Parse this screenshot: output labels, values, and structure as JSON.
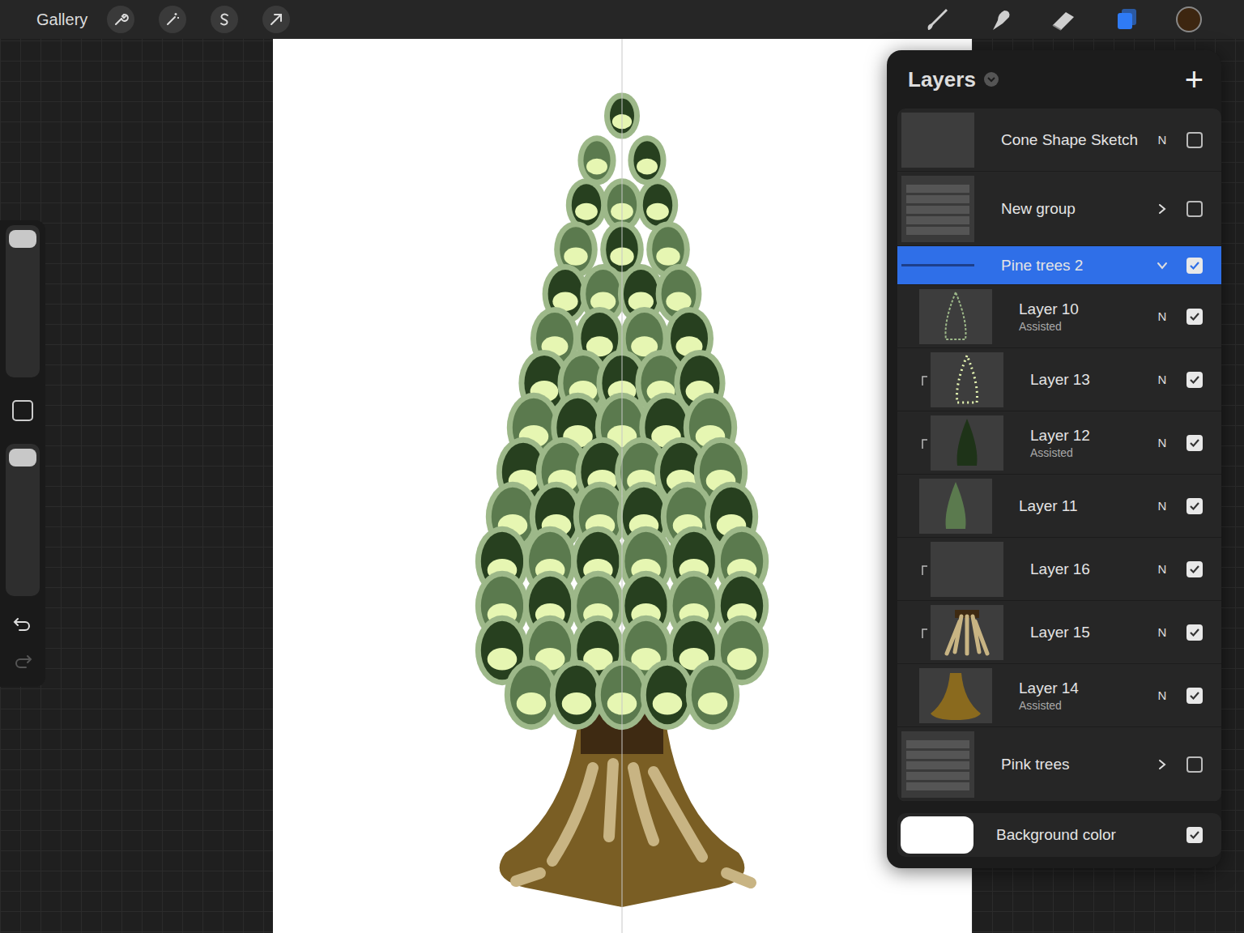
{
  "toolbar": {
    "gallery": "Gallery",
    "current_color": "#3d2610",
    "layers_open": true
  },
  "sidebar": {
    "size_slider": {
      "level": 1
    },
    "opacity_slider": {
      "level": 1
    },
    "redo_disabled": true
  },
  "layers_panel": {
    "title": "Layers",
    "add": "+",
    "rows": [
      {
        "name": "Cone Shape Sketch",
        "kind": "layer",
        "subtitle": "",
        "blend": "N",
        "visible": false,
        "selected": false,
        "expanded": false,
        "child": false,
        "clipped": false
      },
      {
        "name": "New group",
        "kind": "group",
        "subtitle": "",
        "blend": "",
        "visible": false,
        "selected": false,
        "expanded": false,
        "child": false,
        "clipped": false
      },
      {
        "name": "Pine trees 2",
        "kind": "group",
        "subtitle": "",
        "blend": "",
        "visible": true,
        "selected": true,
        "expanded": true,
        "child": false,
        "clipped": false
      },
      {
        "name": "Layer 10",
        "kind": "layer",
        "subtitle": "Assisted",
        "blend": "N",
        "visible": true,
        "selected": false,
        "expanded": false,
        "child": true,
        "clipped": false
      },
      {
        "name": "Layer 13",
        "kind": "layer",
        "subtitle": "",
        "blend": "N",
        "visible": true,
        "selected": false,
        "expanded": false,
        "child": true,
        "clipped": true
      },
      {
        "name": "Layer 12",
        "kind": "layer",
        "subtitle": "Assisted",
        "blend": "N",
        "visible": true,
        "selected": false,
        "expanded": false,
        "child": true,
        "clipped": true
      },
      {
        "name": "Layer 11",
        "kind": "layer",
        "subtitle": "",
        "blend": "N",
        "visible": true,
        "selected": false,
        "expanded": false,
        "child": true,
        "clipped": false
      },
      {
        "name": "Layer 16",
        "kind": "layer",
        "subtitle": "",
        "blend": "N",
        "visible": true,
        "selected": false,
        "expanded": false,
        "child": true,
        "clipped": true
      },
      {
        "name": "Layer 15",
        "kind": "layer",
        "subtitle": "",
        "blend": "N",
        "visible": true,
        "selected": false,
        "expanded": false,
        "child": true,
        "clipped": true
      },
      {
        "name": "Layer 14",
        "kind": "layer",
        "subtitle": "Assisted",
        "blend": "N",
        "visible": true,
        "selected": false,
        "expanded": false,
        "child": true,
        "clipped": false
      },
      {
        "name": "Pink trees",
        "kind": "group",
        "subtitle": "",
        "blend": "",
        "visible": false,
        "selected": false,
        "expanded": false,
        "child": false,
        "clipped": false
      }
    ],
    "background": {
      "name": "Background color",
      "color": "#ffffff",
      "visible": true
    }
  }
}
